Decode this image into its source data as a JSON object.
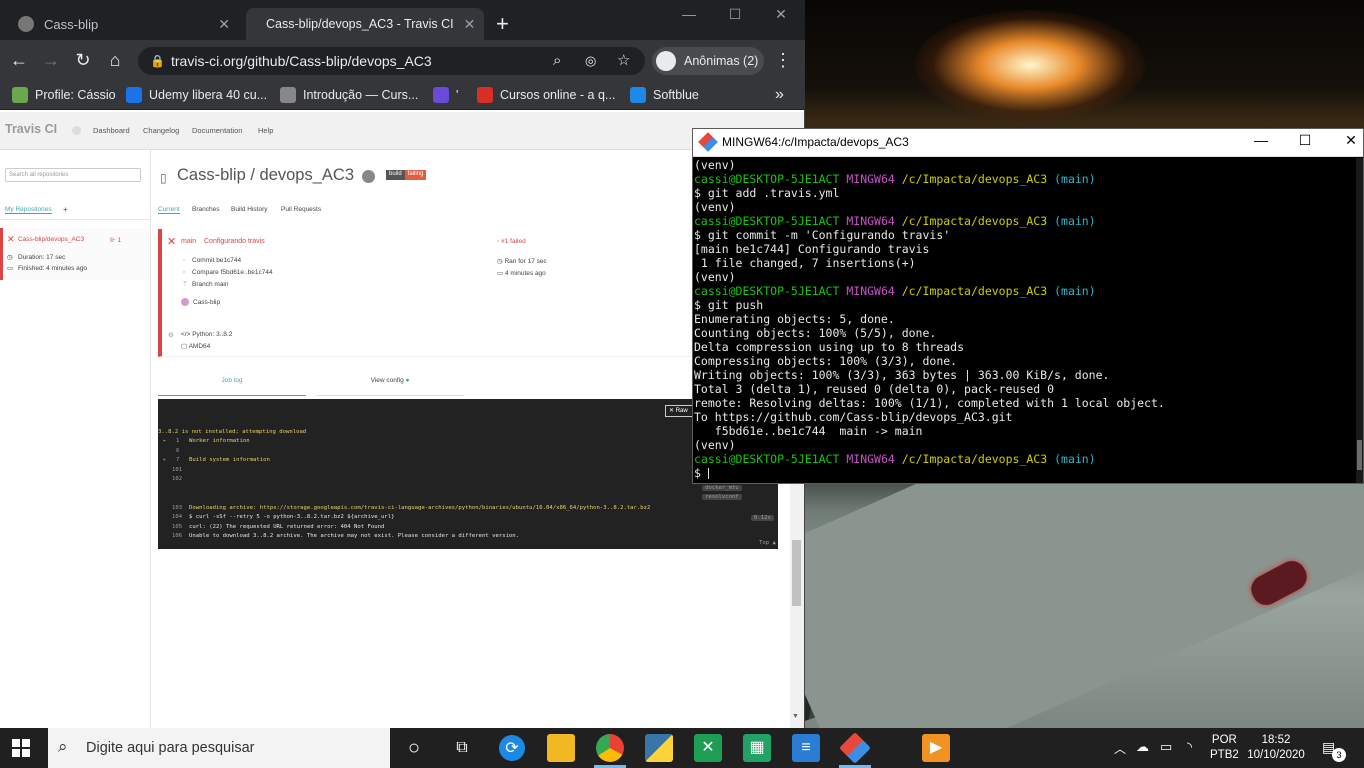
{
  "browser": {
    "tabs": [
      {
        "title": "Cass-blip",
        "close": "✕"
      },
      {
        "title": "Cass-blip/devops_AC3 - Travis CI",
        "close": "✕"
      }
    ],
    "new_tab": "+",
    "window": {
      "minimize": "—",
      "maximize": "☐",
      "close": "✕"
    },
    "url": "travis-ci.org/github/Cass-blip/devops_AC3",
    "profile": "Anônimas (2)",
    "bookmarks": [
      {
        "label": "Profile: Cássio",
        "color": "#6aa84f"
      },
      {
        "label": "Udemy libera 40 cu...",
        "color": "#1a73e8"
      },
      {
        "label": "Introdução — Curs...",
        "color": "#888888"
      },
      {
        "label": "'",
        "color": "#6c4ad8"
      },
      {
        "label": "Cursos online - a q...",
        "color": "#d93025"
      },
      {
        "label": "Softblue",
        "color": "#1e88e5"
      }
    ],
    "more_bookmarks": "»"
  },
  "travis": {
    "logo": "Travis CI",
    "nav": [
      "Dashboard",
      "Changelog",
      "Documentation",
      "Help"
    ],
    "search_placeholder": "Search all repositories",
    "my_repos": "My Repositories",
    "add": "+",
    "repo_item": {
      "name": "Cass-blip/devops_AC3",
      "count": "1",
      "duration": "Duration: 17 sec",
      "finished": "Finished: 4 minutes ago"
    },
    "title": "Cass-blip / devops_AC3",
    "badge": {
      "left": "build",
      "right": "failing"
    },
    "subnav": [
      "Current",
      "Branches",
      "Build History",
      "Pull Requests"
    ],
    "build": {
      "branch": "main",
      "message": "Configurando travis",
      "commit": "Commit be1c744",
      "compare": "Compare f5bd61e..be1c744",
      "branch_line": "Branch main",
      "author": "Cass-blip",
      "status": "#1 failed",
      "ran": "Ran for 17 sec",
      "ago": "4 minutes ago",
      "python": "Python: 3..8.2",
      "arch": "AMD64"
    },
    "tabs": {
      "job_log": "Job log",
      "view_config": "View config"
    },
    "log": {
      "raw": "Raw",
      "lines": [
        {
          "num": "",
          "text": "3..8.2 is not installed; attempting download",
          "style": "y"
        },
        {
          "num": "1",
          "text": "Worker information",
          "style": "y"
        },
        {
          "num": "6",
          "text": "",
          "style": "g"
        },
        {
          "num": "7",
          "text": "Build system information",
          "style": "y"
        },
        {
          "num": "101",
          "text": "",
          "style": "g"
        },
        {
          "num": "102",
          "text": "",
          "style": "g"
        },
        {
          "num": "103",
          "text": "Downloading archive: https://storage.googleapis.com/travis-ci-language-archives/python/binaries/ubuntu/16.04/x86_64/python-3..8.2.tar.bz2",
          "style": "y"
        },
        {
          "num": "104",
          "text": "$ curl -sSf --retry 5 -o python-3..8.2.tar.bz2 ${archive_url}",
          "style": "w"
        },
        {
          "num": "105",
          "text": "curl: (22) The requested URL returned error: 404 Not Found",
          "style": "w"
        },
        {
          "num": "106",
          "text": "Unable to download 3..8.2 archive. The archive may not exist. Please consider a different version.",
          "style": "w"
        }
      ],
      "tags": [
        "docker_mtu",
        "resolvconf"
      ],
      "time": "0.12s",
      "top": "Top ▲"
    }
  },
  "terminal": {
    "title": "MINGW64:/c/Impacta/devops_AC3",
    "prompt_user": "cassi@DESKTOP-5JE1ACT",
    "prompt_env": "MINGW64",
    "prompt_path": "/c/Impacta/devops_AC3",
    "prompt_branch": "(main)",
    "lines": [
      "(venv)",
      "$ git add .travis.yml",
      "(venv)",
      "$ git commit -m 'Configurando travis'",
      "[main be1c744] Configurando travis",
      " 1 file changed, 7 insertions(+)",
      "(venv)",
      "$ git push",
      "Enumerating objects: 5, done.",
      "Counting objects: 100% (5/5), done.",
      "Delta compression using up to 8 threads",
      "Compressing objects: 100% (3/3), done.",
      "Writing objects: 100% (3/3), 363 bytes | 363.00 KiB/s, done.",
      "Total 3 (delta 1), reused 0 (delta 0), pack-reused 0",
      "remote: Resolving deltas: 100% (1/1), completed with 1 local object.",
      "To https://github.com/Cass-blip/devops_AC3.git",
      "   f5bd61e..be1c744  main -> main",
      "(venv)",
      "$ "
    ]
  },
  "taskbar": {
    "search_placeholder": "Digite aqui para pesquisar",
    "lang": "POR",
    "layout": "PTB2",
    "time": "18:52",
    "date": "10/10/2020",
    "notifications": "3"
  }
}
